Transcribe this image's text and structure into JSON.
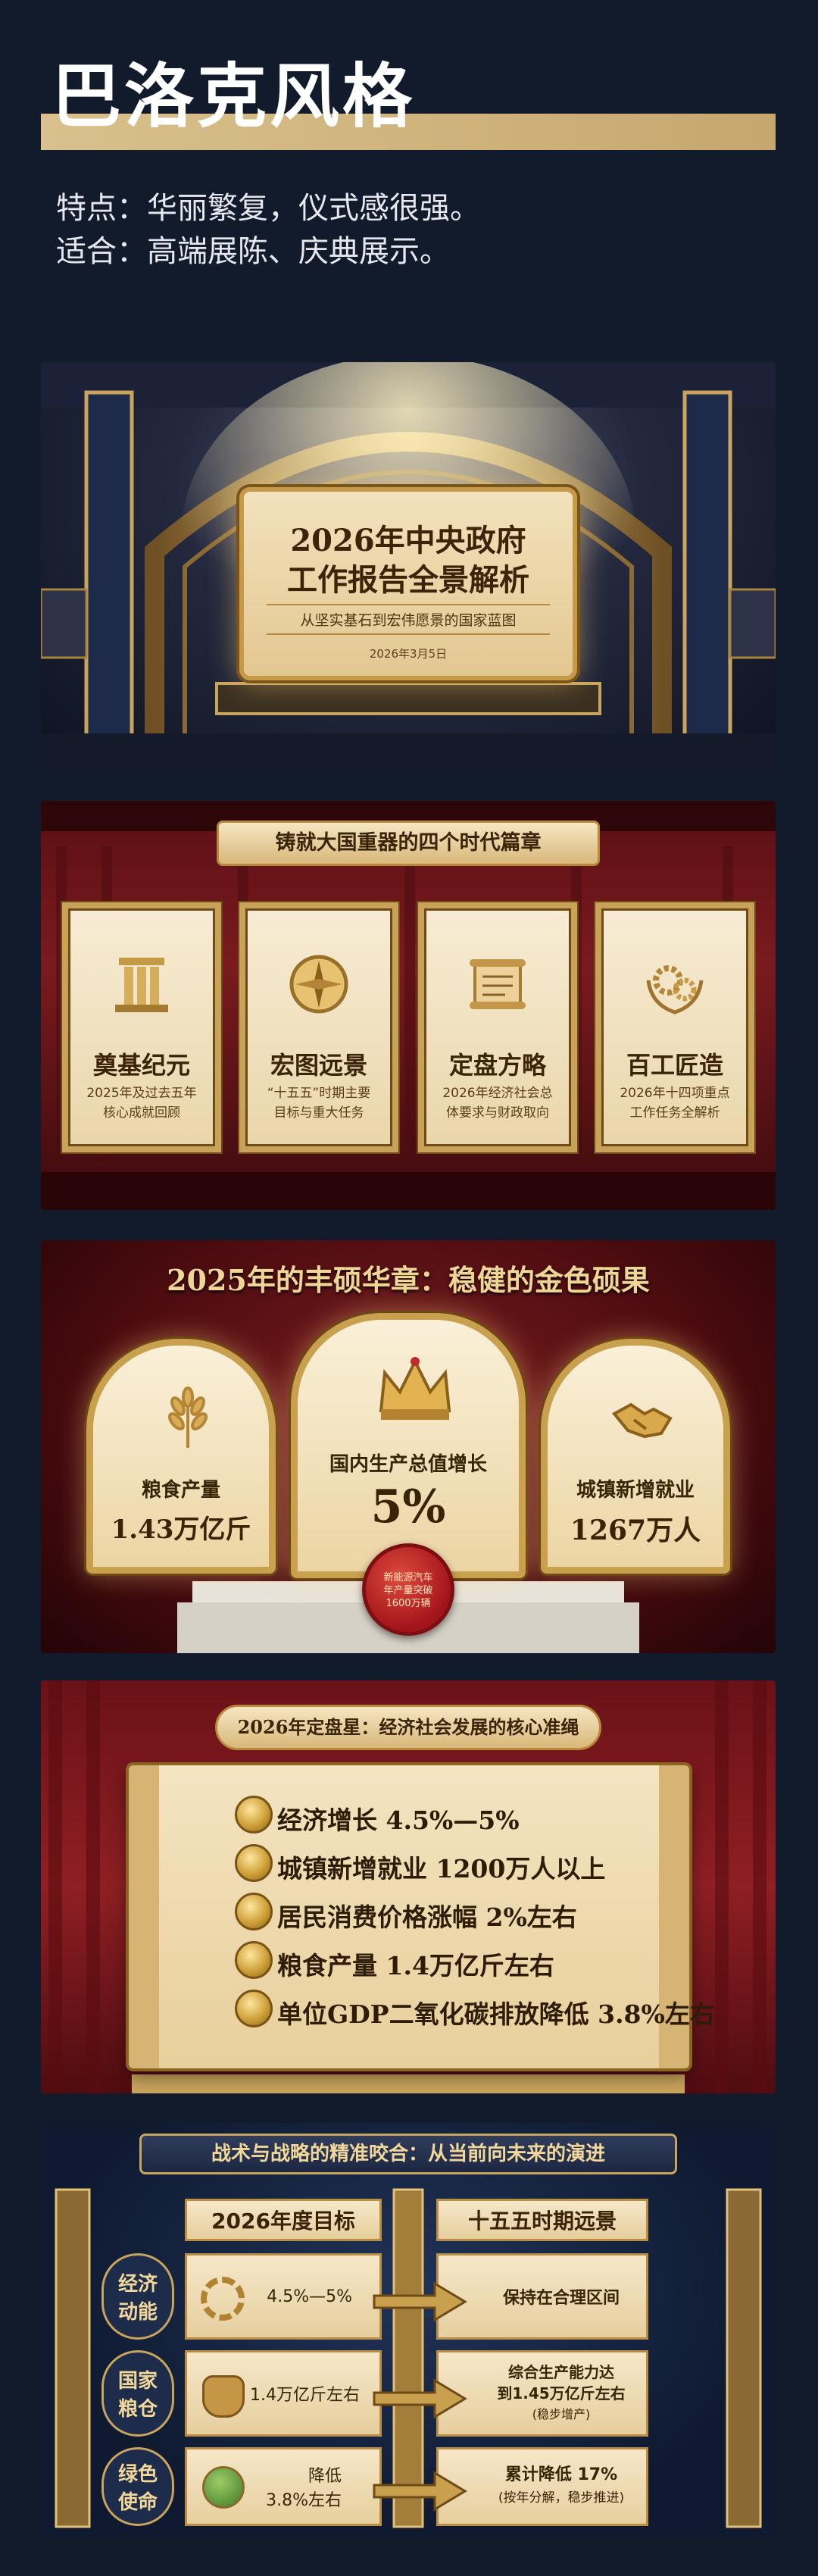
{
  "header": {
    "title": "巴洛克风格",
    "line1": "特点：华丽繁复，仪式感很强。",
    "line2": "适合：高端展陈、庆典展示。"
  },
  "slide1": {
    "title_line1": "2026年中央政府",
    "title_line2": "工作报告全景解析",
    "subtitle": "从坚实基石到宏伟愿景的国家蓝图",
    "date": "2026年3月5日"
  },
  "slide2": {
    "banner": "铸就大国重器的四个时代篇章",
    "cards": [
      {
        "icon": "pillar-icon",
        "title": "奠基纪元",
        "line1": "2025年及过去五年",
        "line2": "核心成就回顾"
      },
      {
        "icon": "compass-icon",
        "title": "宏图远景",
        "line1": "“十五五”时期主要",
        "line2": "目标与重大任务"
      },
      {
        "icon": "scroll-icon",
        "title": "定盘方略",
        "line1": "2026年经济社会总",
        "line2": "体要求与财政取向"
      },
      {
        "icon": "gears-laurel-icon",
        "title": "百工匠造",
        "line1": "2026年十四项重点",
        "line2": "工作任务全解析"
      }
    ]
  },
  "slide3": {
    "title": "2025年的丰硕华章：稳健的金色硕果",
    "left": {
      "icon": "wheat-icon",
      "label": "粮食产量",
      "value": "1.43万亿斤"
    },
    "center": {
      "icon": "crown-icon",
      "label": "国内生产总值增长",
      "value": "5%"
    },
    "right": {
      "icon": "handshake-icon",
      "label": "城镇新增就业",
      "value": "1267万人"
    },
    "seal": {
      "line1": "新能源汽车",
      "line2": "年产量突破",
      "line3": "1600万辆"
    }
  },
  "slide4": {
    "banner": "2026年定盘星：经济社会发展的核心准绳",
    "targets": [
      "经济增长 4.5%—5%",
      "城镇新增就业 1200万人以上",
      "居民消费价格涨幅 2%左右",
      "粮食产量 1.4万亿斤左右",
      "单位GDP二氧化碳排放降低 3.8%左右"
    ]
  },
  "slide5": {
    "banner": "战术与战略的精准咬合：从当前向未来的演进",
    "col_headers": [
      "2026年度目标",
      "十五五时期远景"
    ],
    "rows": [
      {
        "label_1": "经济",
        "label_2": "动能",
        "icon": "gear-chart-icon",
        "goal_1": "4.5%—5%",
        "goal_2": "",
        "vision_1": "保持在合理区间",
        "vision_2": "",
        "vision_3": ""
      },
      {
        "label_1": "国家",
        "label_2": "粮仓",
        "icon": "grain-sack-icon",
        "goal_1": "1.4万亿斤左右",
        "goal_2": "",
        "vision_1": "综合生产能力达",
        "vision_2": "到1.45万亿斤左右",
        "vision_3": "(稳步增产)"
      },
      {
        "label_1": "绿色",
        "label_2": "使命",
        "icon": "green-globe-icon",
        "goal_1": "降低",
        "goal_2": "3.8%左右",
        "vision_1": "累计降低 17%",
        "vision_2": "(按年分解，稳步推进)",
        "vision_3": ""
      }
    ]
  }
}
